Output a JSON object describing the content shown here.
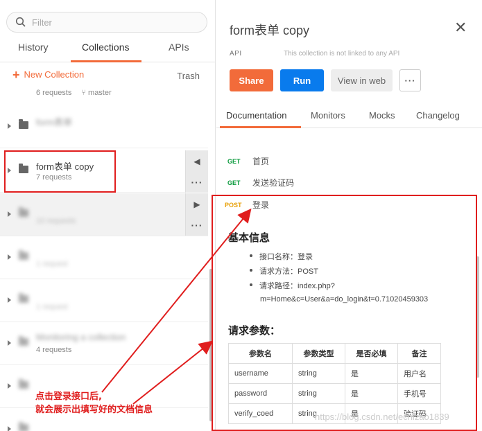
{
  "sidebar": {
    "search_placeholder": "Filter",
    "tabs": [
      "History",
      "Collections",
      "APIs"
    ],
    "new_collection_label": "New Collection",
    "trash_label": "Trash",
    "top_partial": {
      "requests": "6 requests",
      "branch": "master"
    },
    "collections": [
      {
        "name": "form表单",
        "sub": "",
        "blurred": true
      },
      {
        "name": "form表单 copy",
        "sub": "7 requests",
        "blurred": false
      },
      {
        "name": "",
        "sub": "10 requests",
        "blurred": true
      },
      {
        "name": "",
        "sub": "1 request",
        "blurred": true
      },
      {
        "name": "",
        "sub": "1 request",
        "blurred": true
      },
      {
        "name": "Monitoring a collection",
        "sub": "4 requests",
        "blurred": true
      },
      {
        "name": "",
        "sub": "",
        "blurred": true
      },
      {
        "name": "",
        "sub": "",
        "blurred": true
      }
    ]
  },
  "panel": {
    "title": "form表单 copy",
    "api_label": "API",
    "api_note": "This collection is not linked to any API",
    "buttons": {
      "share": "Share",
      "run": "Run",
      "view_web": "View in web",
      "more": "···"
    },
    "tabs": [
      "Documentation",
      "Monitors",
      "Mocks",
      "Changelog"
    ],
    "requests": [
      {
        "method": "GET",
        "name": "首页"
      },
      {
        "method": "GET",
        "name": "发送验证码"
      },
      {
        "method": "POST",
        "name": "登录"
      }
    ],
    "doc": {
      "basic_heading": "基本信息",
      "basic_items": [
        "接口名称：登录",
        "请求方法：POST",
        "请求路径：index.php?"
      ],
      "path_cont": "m=Home&c=User&a=do_login&t=0.71020459303",
      "params_heading": "请求参数：",
      "table_headers": [
        "参数名",
        "参数类型",
        "是否必填",
        "备注"
      ],
      "table_rows": [
        [
          "username",
          "string",
          "是",
          "用户名"
        ],
        [
          "password",
          "string",
          "是",
          "手机号"
        ],
        [
          "verify_coed",
          "string",
          "是",
          "验证码"
        ]
      ]
    }
  },
  "annotation": {
    "line1": "点击登录接口后,",
    "line2": "就会展示出填写好的文档信息",
    "color": "#e01e1e"
  },
  "watermark": "https://blog.csdn.net/echizao1839",
  "colors": {
    "accent": "#f26b3a",
    "run": "#097bed",
    "get": "#0c9b3e",
    "post": "#e8a10a"
  }
}
